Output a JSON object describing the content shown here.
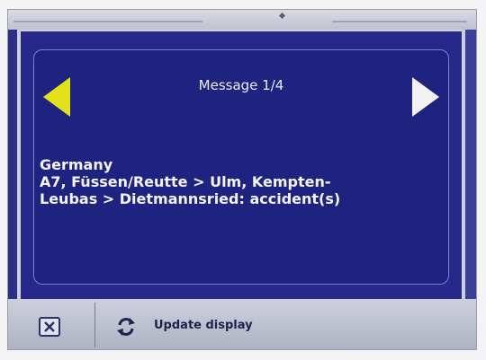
{
  "message": {
    "title": "Message 1/4",
    "lines": [
      "Germany",
      "A7, Füssen/Reutte > Ulm, Kempten-",
      "Leubas > Dietmannsried:  accident(s)"
    ]
  },
  "toolbar": {
    "update_label": "Update display"
  },
  "icons": {
    "prev": "left-arrow-icon",
    "next": "right-arrow-icon",
    "close": "close-icon",
    "refresh": "refresh-icon"
  },
  "colors": {
    "dialog_bg": "#26298a",
    "prev_arrow": "#e3e21a",
    "next_arrow": "#f2f2f6",
    "text": "#f4f4fa"
  }
}
